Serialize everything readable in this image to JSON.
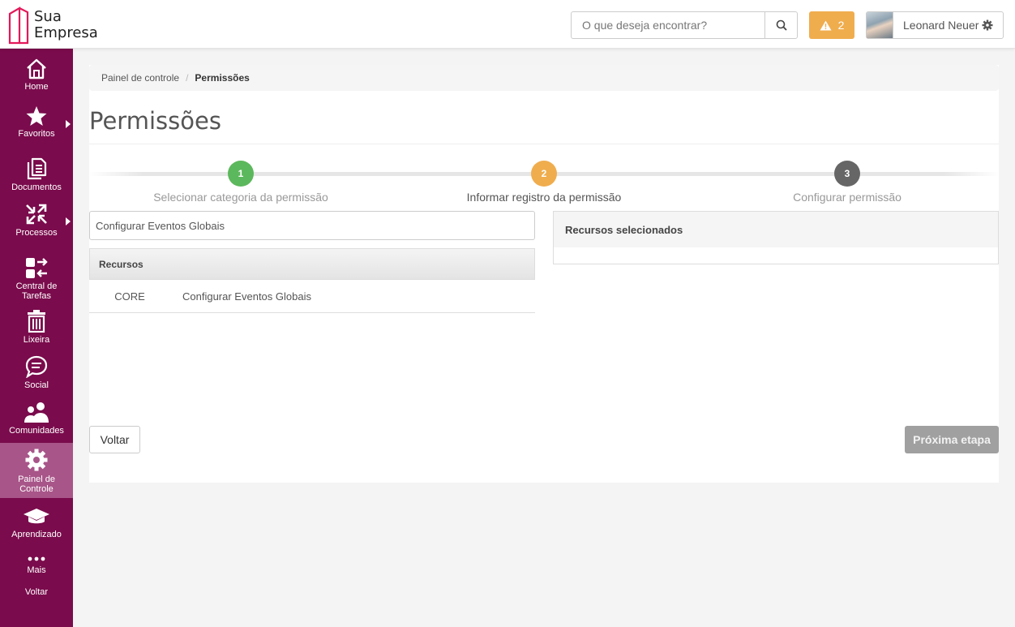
{
  "header": {
    "logo_line1": "Sua",
    "logo_line2": "Empresa",
    "search_placeholder": "O que deseja encontrar?",
    "alert_count": "2",
    "user_name": "Leonard Neuer",
    "colors": {
      "alert": "#f0ad4e",
      "brand": "#7a0b4c"
    }
  },
  "sidebar": {
    "items": [
      {
        "label": "Home",
        "icon": "home-icon"
      },
      {
        "label": "Favoritos",
        "icon": "star-icon"
      },
      {
        "label": "Documentos",
        "icon": "documents-icon"
      },
      {
        "label": "Processos",
        "icon": "processes-icon"
      },
      {
        "label": "Central de Tarefas",
        "icon": "tasks-icon"
      },
      {
        "label": "Lixeira",
        "icon": "trash-icon"
      },
      {
        "label": "Social",
        "icon": "chat-icon"
      },
      {
        "label": "Comunidades",
        "icon": "communities-icon"
      },
      {
        "label": "Painel de Controle",
        "icon": "gear-icon"
      },
      {
        "label": "Aprendizado",
        "icon": "graduation-icon"
      },
      {
        "label": "Mais",
        "icon": "more-icon"
      },
      {
        "label": "Voltar"
      }
    ]
  },
  "breadcrumb": {
    "parent": "Painel de controle",
    "separator": "/",
    "current": "Permissões"
  },
  "page_title": "Permissões",
  "steps": [
    {
      "number": "1",
      "label": "Selecionar categoria da permissão",
      "color": "#5cb85c"
    },
    {
      "number": "2",
      "label": "Informar registro da permissão",
      "color": "#f0ad4e"
    },
    {
      "number": "3",
      "label": "Configurar permissão",
      "color": "#666666"
    }
  ],
  "left_panel": {
    "input_value": "Configurar Eventos Globais",
    "table_header": "Recursos",
    "rows": [
      {
        "code": "CORE",
        "name": "Configurar Eventos Globais"
      }
    ]
  },
  "right_panel": {
    "header": "Recursos selecionados"
  },
  "buttons": {
    "back": "Voltar",
    "next": "Próxima etapa"
  }
}
